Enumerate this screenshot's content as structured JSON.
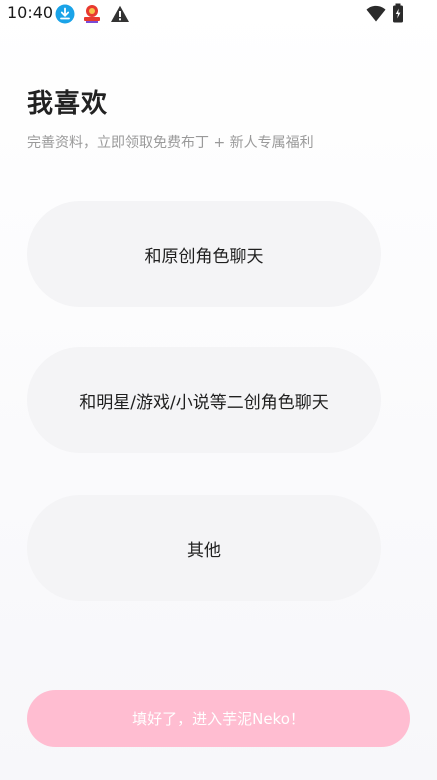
{
  "status_bar": {
    "time": "10:40",
    "icons": [
      "download-icon",
      "app-badge-icon",
      "warning-icon",
      "wifi-icon",
      "battery-icon"
    ],
    "colors": {
      "download": "#1aa3e8",
      "warning": "#333333"
    }
  },
  "header": {
    "title": "我喜欢",
    "subtitle": "完善资料，立即领取免费布丁 + 新人专属福利"
  },
  "options": [
    {
      "label": "和原创角色聊天"
    },
    {
      "label": "和明星/游戏/小说等二创角色聊天"
    },
    {
      "label": "其他"
    }
  ],
  "submit": {
    "label": "填好了，进入芋泥Neko！",
    "color": "#ffbdd1"
  }
}
